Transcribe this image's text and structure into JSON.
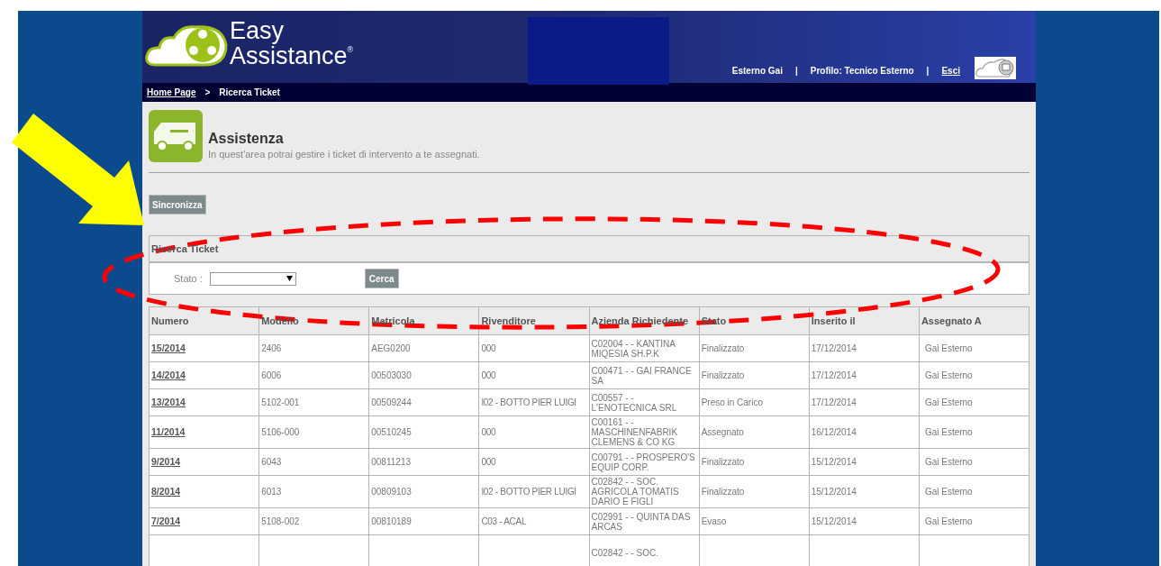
{
  "header": {
    "logo_line1": "Easy",
    "logo_line2": "Assistance",
    "logo_mark": "®",
    "user": "Esterno Gai",
    "separator_1": "|",
    "profile": "Profilo: Tecnico Esterno",
    "separator_2": "|",
    "logout": "Esci"
  },
  "breadcrumb": {
    "home": "Home Page",
    "separator": ">",
    "current": "Ricerca Ticket"
  },
  "section": {
    "title": "Assistenza",
    "subtitle": "In quest'area potrai gestire i ticket di intervento a te assegnati."
  },
  "sync_button": "Sincronizza",
  "search_panel": {
    "title": "Ricerca Ticket",
    "field_label": "Stato :",
    "button": "Cerca"
  },
  "table": {
    "columns": [
      "Numero",
      "Modello",
      "Matricola",
      "Rivenditore",
      "Azienda Richiedente",
      "Stato",
      "Inserito il",
      "Assegnato A"
    ],
    "rows": [
      {
        "numero": "15/2014",
        "modello": "2406",
        "matricola": "AEG0200",
        "rivenditore": "000",
        "azienda": "C02004 - - KANTINA MIQESIA SH.P.K",
        "stato": "Finalizzato",
        "inserito": "17/12/2014",
        "assegnato": "Gai Esterno"
      },
      {
        "numero": "14/2014",
        "modello": "6006",
        "matricola": "00503030",
        "rivenditore": "000",
        "azienda": "C00471 - - GAI FRANCE SA",
        "stato": "Finalizzato",
        "inserito": "17/12/2014",
        "assegnato": "Gai Esterno"
      },
      {
        "numero": "13/2014",
        "modello": "5102-001",
        "matricola": "00509244",
        "rivenditore": "I02 - BOTTO PIER LUIGI",
        "azienda": "C00557 - - L'ENOTECNICA SRL",
        "stato": "Preso in Carico",
        "inserito": "17/12/2014",
        "assegnato": "Gai Esterno"
      },
      {
        "numero": "11/2014",
        "modello": "5106-000",
        "matricola": "00510245",
        "rivenditore": "000",
        "azienda": "C00161 - - MASCHINENFABRIK CLEMENS & CO KG",
        "stato": "Assegnato",
        "inserito": "16/12/2014",
        "assegnato": "Gai Esterno"
      },
      {
        "numero": "9/2014",
        "modello": "6043",
        "matricola": "00811213",
        "rivenditore": "000",
        "azienda": "C00791 - - PROSPERO'S EQUIP CORP.",
        "stato": "Finalizzato",
        "inserito": "15/12/2014",
        "assegnato": "Gai Esterno"
      },
      {
        "numero": "8/2014",
        "modello": "6013",
        "matricola": "00809103",
        "rivenditore": "I02 - BOTTO PIER LUIGI",
        "azienda": "C02842 - - SOC. AGRICOLA TOMATIS DARIO E FIGLI",
        "stato": "Finalizzato",
        "inserito": "15/12/2014",
        "assegnato": "Gai Esterno"
      },
      {
        "numero": "7/2014",
        "modello": "5108-002",
        "matricola": "00810189",
        "rivenditore": "C03 - ACAL",
        "azienda": "C02991 - - QUINTA DAS ARCAS",
        "stato": "Evaso",
        "inserito": "15/12/2014",
        "assegnato": "Gai Esterno"
      },
      {
        "azienda": "C02842 - - SOC."
      }
    ]
  }
}
